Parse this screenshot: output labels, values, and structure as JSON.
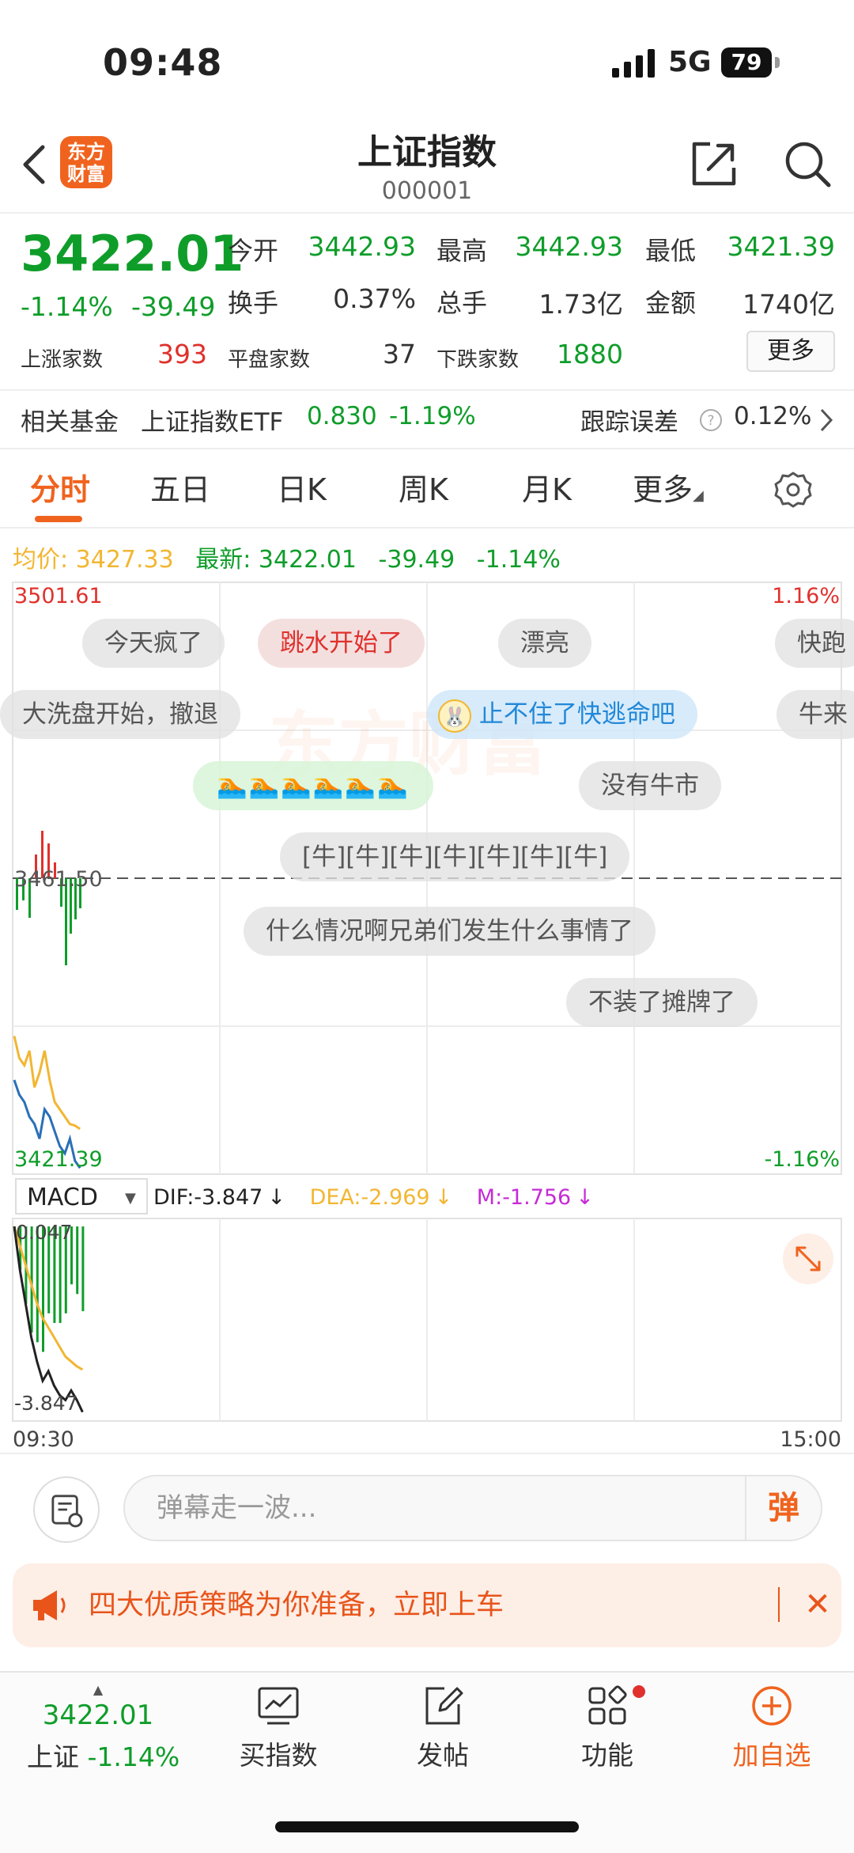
{
  "status_bar": {
    "time": "09:48",
    "network": "5G",
    "battery": "79"
  },
  "header": {
    "logo_text": "东方\n财富",
    "title": "上证指数",
    "code": "000001"
  },
  "quote": {
    "price": "3422.01",
    "change_pct": "-1.14%",
    "change": "-39.49",
    "open_label": "今开",
    "open": "3442.93",
    "high_label": "最高",
    "high": "3442.93",
    "low_label": "最低",
    "low": "3421.39",
    "turnover_label": "换手",
    "turnover": "0.37%",
    "volume_label": "总手",
    "volume": "1.73亿",
    "amount_label": "金额",
    "amount": "1740亿",
    "up_label": "上涨家数",
    "up": "393",
    "flat_label": "平盘家数",
    "flat": "37",
    "down_label": "下跌家数",
    "down": "1880",
    "more_label": "更多"
  },
  "fund": {
    "label": "相关基金",
    "name": "上证指数ETF",
    "price": "0.830",
    "pct": "-1.19%",
    "tracking_label": "跟踪误差",
    "tracking_value": "0.12%"
  },
  "tabs": [
    "分时",
    "五日",
    "日K",
    "周K",
    "月K",
    "更多"
  ],
  "legend": {
    "avg_label": "均价:",
    "avg_value": "3427.33",
    "latest_label": "最新:",
    "latest_value": "3422.01",
    "latest_change": "-39.49",
    "latest_pct": "-1.14%"
  },
  "chart_data": {
    "type": "line",
    "price_axis": {
      "top": "3501.61",
      "mid": "3461.50",
      "bottom": "3421.39",
      "top_pct": "1.16%",
      "bottom_pct": "-1.16%"
    },
    "x_axis": {
      "start": "09:30",
      "end": "15:00"
    },
    "series": [
      {
        "name": "最新",
        "color": "#2a6fb8",
        "values": [
          3434,
          3432,
          3431,
          3429,
          3428,
          3426,
          3430,
          3429,
          3427,
          3425,
          3424,
          3426,
          3423,
          3422.01
        ]
      },
      {
        "name": "均价",
        "color": "#f2b632",
        "values": [
          3440,
          3437,
          3436,
          3438,
          3433,
          3435,
          3438,
          3434,
          3431,
          3430,
          3429,
          3428,
          3427.8,
          3427.33
        ]
      }
    ],
    "ylim": [
      3421.39,
      3501.61
    ]
  },
  "macd": {
    "label": "MACD",
    "dif_label": "DIF:",
    "dif": "-3.847",
    "dea_label": "DEA:",
    "dea": "-2.969",
    "m_label": "M:",
    "m": "-1.756",
    "arrow": "↓",
    "top_label": "0.047",
    "bottom_label": "-3.847",
    "dif_values": [
      0.0,
      -0.9,
      -1.6,
      -2.3,
      -2.8,
      -3.2,
      -3.0,
      -3.3,
      -3.5,
      -3.6,
      -3.4,
      -3.6,
      -3.847
    ],
    "dea_values": [
      0.0,
      -0.4,
      -0.8,
      -1.2,
      -1.6,
      -1.9,
      -2.1,
      -2.3,
      -2.5,
      -2.7,
      -2.8,
      -2.9,
      -2.969
    ],
    "hist_values": [
      -0.1,
      -0.9,
      -1.6,
      -2.2,
      -2.4,
      -2.6,
      -1.8,
      -2.0,
      -2.0,
      -1.8,
      -1.2,
      -1.4,
      -1.756
    ]
  },
  "danmu": [
    "今天疯了",
    "跳水开始了",
    "漂亮",
    "快跑",
    "大洗盘开始，撤退",
    "止不住了快逃命吧",
    "牛来",
    "🏊🏊🏊🏊🏊🏊",
    "没有牛市",
    "[牛][牛][牛][牛][牛][牛][牛]",
    "什么情况啊兄弟们发生什么事情了",
    "不装了摊牌了"
  ],
  "watermark": "东方财富",
  "input": {
    "placeholder": "弹幕走一波...",
    "send_label": "弹"
  },
  "promo": {
    "text": "四大优质策略为你准备，立即上车"
  },
  "bottom_nav": {
    "index_price": "3422.01",
    "index_name": "上证",
    "index_pct": "-1.14%",
    "buy_label": "买指数",
    "post_label": "发帖",
    "func_label": "功能",
    "fav_label": "加自选"
  },
  "colors": {
    "up": "#e0312c",
    "down": "#0f9d2a",
    "accent": "#f0631e",
    "avg": "#f2b632",
    "price_line": "#2a6fb8"
  }
}
